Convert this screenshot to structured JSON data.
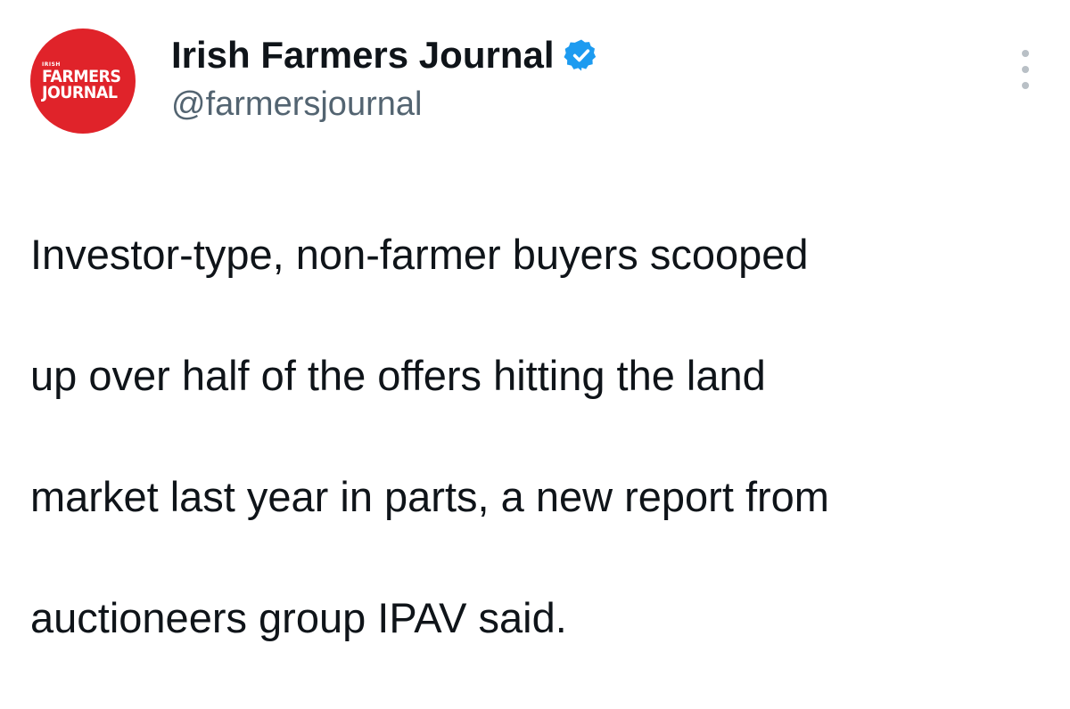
{
  "tweet": {
    "avatar": {
      "icon": "farmers-journal-logo",
      "brand_color": "#e0232a",
      "logo_small": "IRISH",
      "logo_line1": "FARMERS",
      "logo_line2": "JOURNAL"
    },
    "author": {
      "display_name": "Irish Farmers Journal",
      "handle": "@farmersjournal",
      "verified": true,
      "verified_color": "#1d9bf0"
    },
    "more_menu": {
      "icon": "more-vertical-icon"
    },
    "text_lines": [
      "Investor-type, non-farmer buyers scooped",
      "up over half of the offers hitting the land",
      "market last year in parts, a new report from",
      "auctioneers group IPAV said."
    ]
  }
}
